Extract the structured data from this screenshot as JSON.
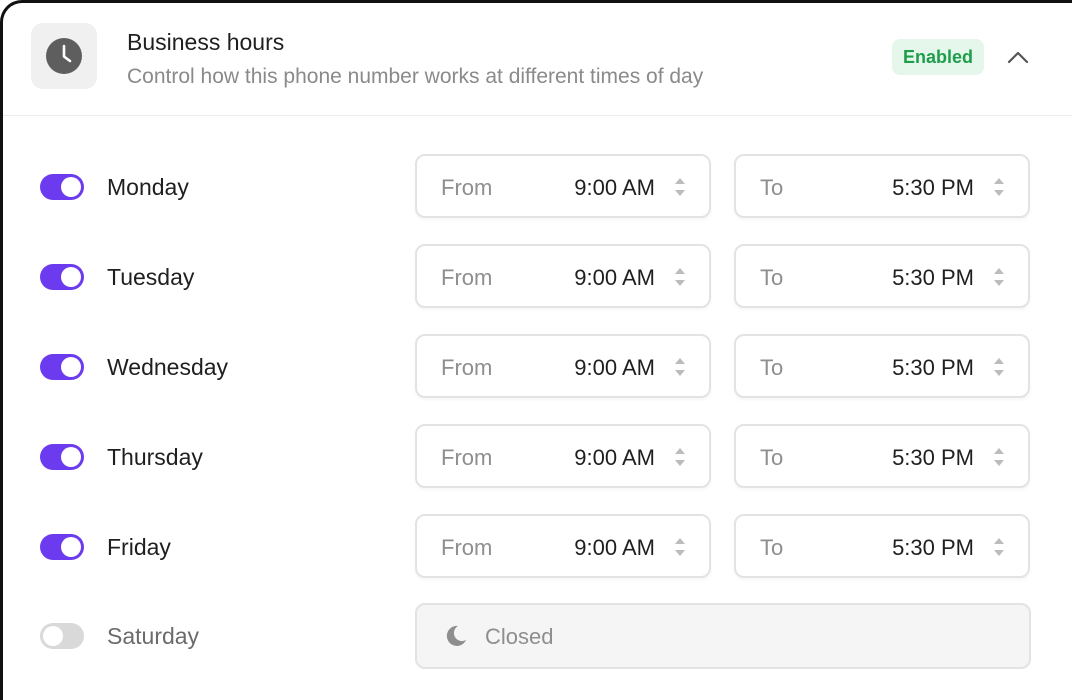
{
  "header": {
    "icon": "clock-icon",
    "title": "Business hours",
    "subtitle": "Control how this phone number works at different times of day",
    "status_badge": "Enabled",
    "collapse_icon": "chevron-up-icon"
  },
  "colors": {
    "toggle_on": "#6c3bf0",
    "toggle_off": "#d9d9d9",
    "badge_bg": "#e4f7ea",
    "badge_text": "#1f9d4c"
  },
  "schedule": [
    {
      "day": "Monday",
      "enabled": true,
      "from_label": "From",
      "from": "9:00 AM",
      "to_label": "To",
      "to": "5:30 PM"
    },
    {
      "day": "Tuesday",
      "enabled": true,
      "from_label": "From",
      "from": "9:00 AM",
      "to_label": "To",
      "to": "5:30 PM"
    },
    {
      "day": "Wednesday",
      "enabled": true,
      "from_label": "From",
      "from": "9:00 AM",
      "to_label": "To",
      "to": "5:30 PM"
    },
    {
      "day": "Thursday",
      "enabled": true,
      "from_label": "From",
      "from": "9:00 AM",
      "to_label": "To",
      "to": "5:30 PM"
    },
    {
      "day": "Friday",
      "enabled": true,
      "from_label": "From",
      "from": "9:00 AM",
      "to_label": "To",
      "to": "5:30 PM"
    },
    {
      "day": "Saturday",
      "enabled": false,
      "closed_label": "Closed",
      "closed_icon": "moon-icon"
    }
  ]
}
